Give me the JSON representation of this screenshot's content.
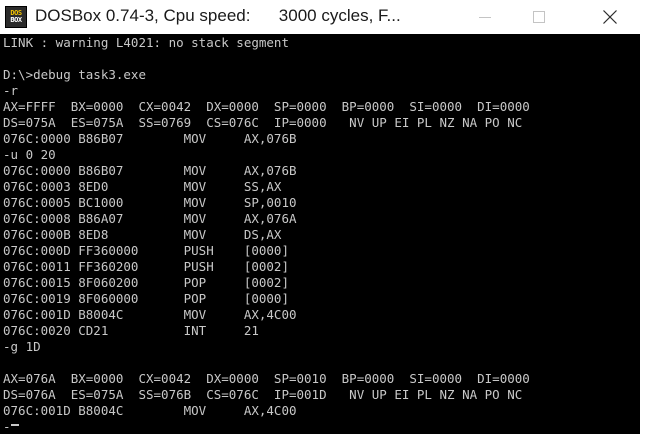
{
  "window": {
    "title": "DOSBox 0.74-3, Cpu speed:      3000 cycles, F...",
    "icon_text_top": "DOS",
    "icon_text_bottom": "BOX"
  },
  "terminal": {
    "lines": [
      "LINK : warning L4021: no stack segment",
      "",
      "D:\\>debug task3.exe",
      "-r",
      "AX=FFFF  BX=0000  CX=0042  DX=0000  SP=0000  BP=0000  SI=0000  DI=0000",
      "DS=075A  ES=075A  SS=0769  CS=076C  IP=0000   NV UP EI PL NZ NA PO NC",
      "076C:0000 B86B07        MOV     AX,076B",
      "-u 0 20",
      "076C:0000 B86B07        MOV     AX,076B",
      "076C:0003 8ED0          MOV     SS,AX",
      "076C:0005 BC1000        MOV     SP,0010",
      "076C:0008 B86A07        MOV     AX,076A",
      "076C:000B 8ED8          MOV     DS,AX",
      "076C:000D FF360000      PUSH    [0000]",
      "076C:0011 FF360200      PUSH    [0002]",
      "076C:0015 8F060200      POP     [0002]",
      "076C:0019 8F060000      POP     [0000]",
      "076C:001D B8004C        MOV     AX,4C00",
      "076C:0020 CD21          INT     21",
      "-g 1D",
      "",
      "AX=076A  BX=0000  CX=0042  DX=0000  SP=0010  BP=0000  SI=0000  DI=0000",
      "DS=076A  ES=075A  SS=076B  CS=076C  IP=001D   NV UP EI PL NZ NA PO NC",
      "076C:001D B8004C        MOV     AX,4C00",
      "-"
    ]
  },
  "colors": {
    "terminal_bg": "#000000",
    "terminal_fg": "#c8c8c8",
    "titlebar_bg": "#ffffff"
  },
  "icons": {
    "minimize": "minimize-icon",
    "maximize": "maximize-icon",
    "close": "close-icon",
    "app": "dosbox-app-icon"
  }
}
